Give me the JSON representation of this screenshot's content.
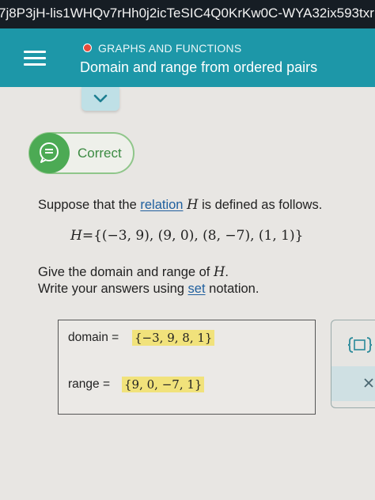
{
  "browser_url": "7j8P3jH-lis1WHQv7rHh0j2icTeSIC4Q0KrKw0C-WYA32ix593txr",
  "header": {
    "topic": "GRAPHS AND FUNCTIONS",
    "title": "Domain and range from ordered pairs",
    "topic_dot_color": "#e64b3c",
    "accent": "#1d97a8"
  },
  "feedback": {
    "label": "Correct",
    "color": "#4caa54"
  },
  "question": {
    "line1": {
      "before": "Suppose that the",
      "link": "relation",
      "var": "H",
      "after": "is defined as follows."
    },
    "relation": {
      "lhs": "H",
      "eq": "=",
      "rhs": "{(−3, 9), (9, 0), (8, −7), (1, 1)}"
    },
    "line2": {
      "before": "Give the domain and range of",
      "var": "H",
      "after": "."
    },
    "line3": {
      "before": "Write your answers using",
      "link": "set",
      "after": "notation."
    }
  },
  "answers": {
    "domain_label": "domain =",
    "domain_value": "{−3, 9, 8, 1}",
    "range_label": "range =",
    "range_value": "{9, 0, −7, 1}"
  },
  "icons": {
    "menu": "hamburger-icon",
    "dropdown": "chevron-down-icon",
    "feedback": "chat-bubble-icon",
    "set_tool": "set-braces-icon",
    "clear": "x-icon"
  }
}
